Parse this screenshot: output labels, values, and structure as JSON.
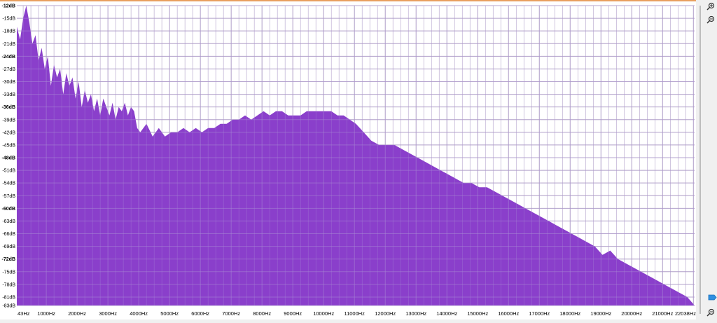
{
  "colors": {
    "fill": "#8a3fcb",
    "background": "#ffffff",
    "grid": "#c8c8c8",
    "top_border": "#e8a060",
    "panel": "#f0f0f0",
    "accent": "#2f8fe0"
  },
  "icons": [
    "zoom-in-icon",
    "zoom-out-icon",
    "slider-handle-icon"
  ],
  "chart_data": {
    "type": "area",
    "title": "",
    "xlabel": "",
    "ylabel": "",
    "xlim": [
      43,
      22038
    ],
    "ylim": [
      -83,
      -12
    ],
    "grid": true,
    "x_ticks": [
      {
        "value": 43,
        "label": "43Hz"
      },
      {
        "value": 1000,
        "label": "1000Hz"
      },
      {
        "value": 2000,
        "label": "2000Hz"
      },
      {
        "value": 3000,
        "label": "3000Hz"
      },
      {
        "value": 4000,
        "label": "4000Hz"
      },
      {
        "value": 5000,
        "label": "5000Hz"
      },
      {
        "value": 6000,
        "label": "6000Hz"
      },
      {
        "value": 7000,
        "label": "7000Hz"
      },
      {
        "value": 8000,
        "label": "8000Hz"
      },
      {
        "value": 9000,
        "label": "9000Hz"
      },
      {
        "value": 10000,
        "label": "10000Hz"
      },
      {
        "value": 11000,
        "label": "11000Hz"
      },
      {
        "value": 12000,
        "label": "12000Hz"
      },
      {
        "value": 13000,
        "label": "13000Hz"
      },
      {
        "value": 14000,
        "label": "14000Hz"
      },
      {
        "value": 15000,
        "label": "15000Hz"
      },
      {
        "value": 16000,
        "label": "16000Hz"
      },
      {
        "value": 17000,
        "label": "17000Hz"
      },
      {
        "value": 18000,
        "label": "18000Hz"
      },
      {
        "value": 19000,
        "label": "19000Hz"
      },
      {
        "value": 20000,
        "label": "20000Hz"
      },
      {
        "value": 21000,
        "label": "21000Hz"
      },
      {
        "value": 22038,
        "label": "22038Hz"
      }
    ],
    "y_ticks": [
      {
        "value": -12,
        "label": "-12dB"
      },
      {
        "value": -15,
        "label": "-15dB"
      },
      {
        "value": -18,
        "label": "-18dB"
      },
      {
        "value": -21,
        "label": "-21dB"
      },
      {
        "value": -24,
        "label": "-24dB"
      },
      {
        "value": -27,
        "label": "-27dB"
      },
      {
        "value": -30,
        "label": "-30dB"
      },
      {
        "value": -33,
        "label": "-33dB"
      },
      {
        "value": -36,
        "label": "-36dB"
      },
      {
        "value": -39,
        "label": "-39dB"
      },
      {
        "value": -42,
        "label": "-42dB"
      },
      {
        "value": -45,
        "label": "-45dB"
      },
      {
        "value": -48,
        "label": "-48dB"
      },
      {
        "value": -51,
        "label": "-51dB"
      },
      {
        "value": -54,
        "label": "-54dB"
      },
      {
        "value": -57,
        "label": "-57dB"
      },
      {
        "value": -60,
        "label": "-60dB"
      },
      {
        "value": -63,
        "label": "-63dB"
      },
      {
        "value": -66,
        "label": "-66dB"
      },
      {
        "value": -69,
        "label": "-69dB"
      },
      {
        "value": -72,
        "label": "-72dB"
      },
      {
        "value": -75,
        "label": "-75dB"
      },
      {
        "value": -78,
        "label": "-78dB"
      },
      {
        "value": -81,
        "label": "-81dB"
      },
      {
        "value": -83,
        "label": "-83dB"
      }
    ],
    "series": [
      {
        "x": [
          43,
          150,
          250,
          350,
          450,
          550,
          650,
          750,
          850,
          950,
          1050,
          1150,
          1250,
          1350,
          1450,
          1550,
          1650,
          1750,
          1850,
          1950,
          2050,
          2150,
          2250,
          2350,
          2450,
          2550,
          2650,
          2750,
          2850,
          2950,
          3050,
          3150,
          3250,
          3350,
          3450,
          3550,
          3650,
          3750,
          3850,
          3950,
          4050,
          4250,
          4450,
          4650,
          4850,
          5050,
          5250,
          5450,
          5650,
          5850,
          6050,
          6250,
          6450,
          6650,
          6850,
          7050,
          7250,
          7450,
          7650,
          7850,
          8050,
          8250,
          8450,
          8650,
          8850,
          9050,
          9250,
          9450,
          9650,
          9850,
          10050,
          10250,
          10450,
          10650,
          10850,
          11050,
          11300,
          11550,
          11800,
          12050,
          12300,
          12550,
          12800,
          13050,
          13300,
          13550,
          13800,
          14050,
          14300,
          14550,
          14800,
          15050,
          15300,
          15550,
          15800,
          16050,
          16300,
          16550,
          16800,
          17050,
          17300,
          17550,
          17800,
          18050,
          18300,
          18550,
          18800,
          19050,
          19300,
          19550,
          19800,
          20050,
          20300,
          20550,
          20800,
          21050,
          21300,
          21550,
          21800,
          22038
        ],
        "y": [
          -17,
          -20,
          -15,
          -12,
          -16,
          -21,
          -19,
          -25,
          -22,
          -27,
          -24,
          -31,
          -26,
          -29,
          -27,
          -33,
          -28,
          -31,
          -29,
          -34,
          -30,
          -36,
          -32,
          -35,
          -33,
          -37,
          -34,
          -38,
          -34,
          -36,
          -38,
          -35,
          -39,
          -36,
          -37,
          -35,
          -38,
          -36,
          -37,
          -41,
          -42,
          -40,
          -43,
          -41,
          -43,
          -42,
          -42,
          -41,
          -42,
          -41,
          -42,
          -41,
          -41,
          -40,
          -40,
          -39,
          -39,
          -38,
          -39,
          -38,
          -37,
          -38,
          -37,
          -37,
          -38,
          -38,
          -38,
          -37,
          -37,
          -37,
          -37,
          -37,
          -38,
          -38,
          -39,
          -40,
          -42,
          -44,
          -45,
          -45,
          -45,
          -46,
          -47,
          -48,
          -49,
          -50,
          -51,
          -52,
          -53,
          -54,
          -54,
          -55,
          -55,
          -56,
          -57,
          -58,
          -59,
          -60,
          -61,
          -62,
          -63,
          -64,
          -65,
          -66,
          -67,
          -68,
          -69,
          -71,
          -70,
          -72,
          -73,
          -74,
          -75,
          -76,
          -77,
          -78,
          -79,
          -80,
          -81,
          -83
        ]
      }
    ]
  }
}
